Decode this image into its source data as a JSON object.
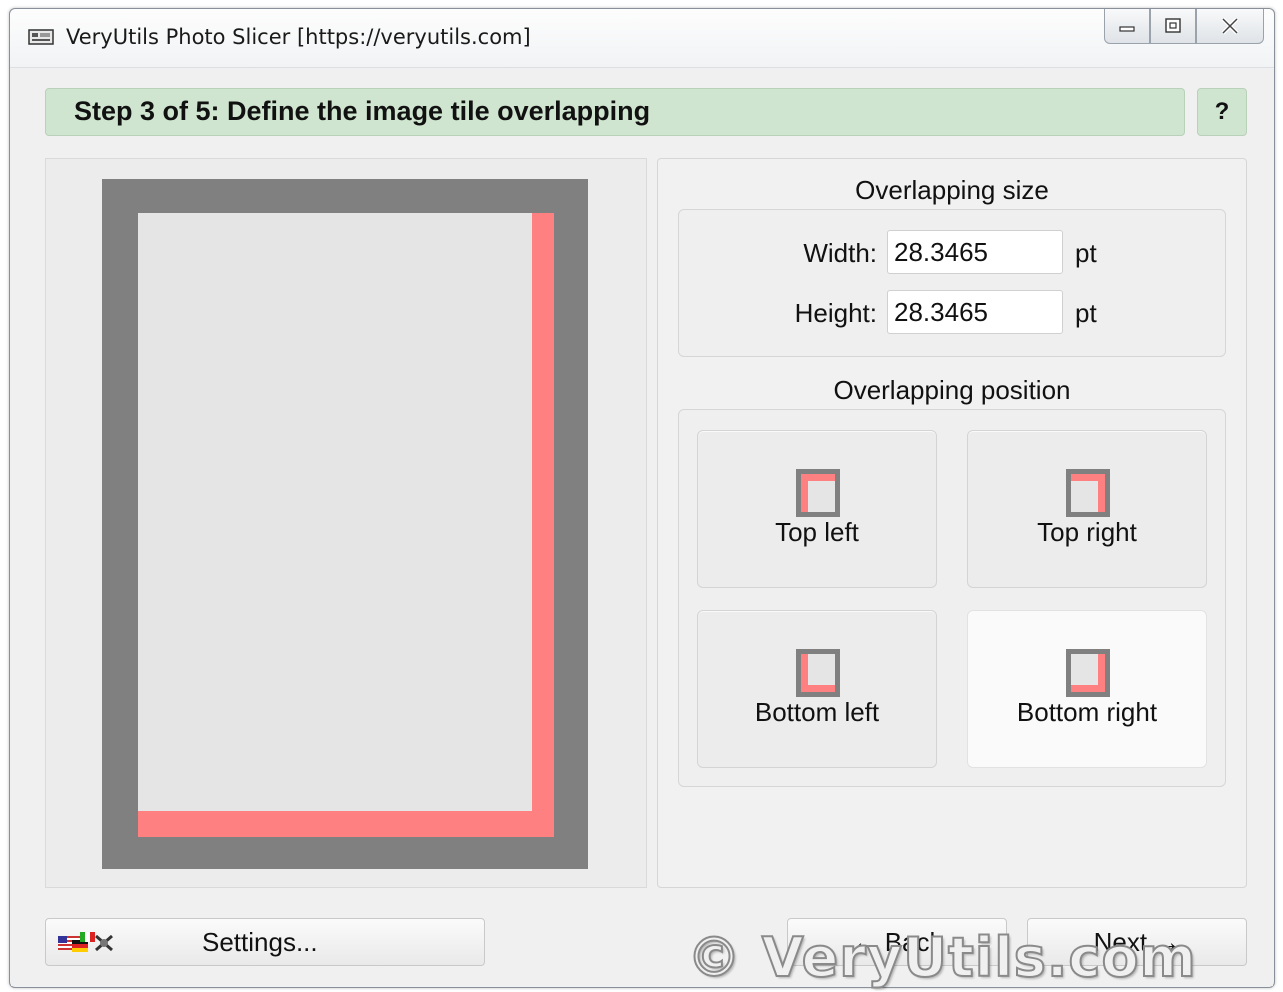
{
  "window": {
    "title": "VeryUtils Photo Slicer [https://veryutils.com]"
  },
  "step": {
    "title": "Step 3 of 5: Define the image tile overlapping",
    "help_label": "?"
  },
  "colors": {
    "overlap": "#ff8080",
    "frame": "#808080",
    "tile": "#e5e5e5",
    "banner": "#cfe5cf"
  },
  "overlap_size": {
    "label": "Overlapping size",
    "width_label": "Width:",
    "width_value": "28.3465",
    "height_label": "Height:",
    "height_value": "28.3465",
    "unit": "pt"
  },
  "overlap_position": {
    "label": "Overlapping position",
    "options": [
      {
        "label": "Top left",
        "icon": "overlap-top-left-icon"
      },
      {
        "label": "Top right",
        "icon": "overlap-top-right-icon"
      },
      {
        "label": "Bottom left",
        "icon": "overlap-bottom-left-icon"
      },
      {
        "label": "Bottom right",
        "icon": "overlap-bottom-right-icon"
      }
    ],
    "selected": "Bottom right"
  },
  "footer": {
    "settings_label": "Settings...",
    "back_label": "Back",
    "next_label": "Next",
    "watermark": "© VeryUtils.com"
  }
}
